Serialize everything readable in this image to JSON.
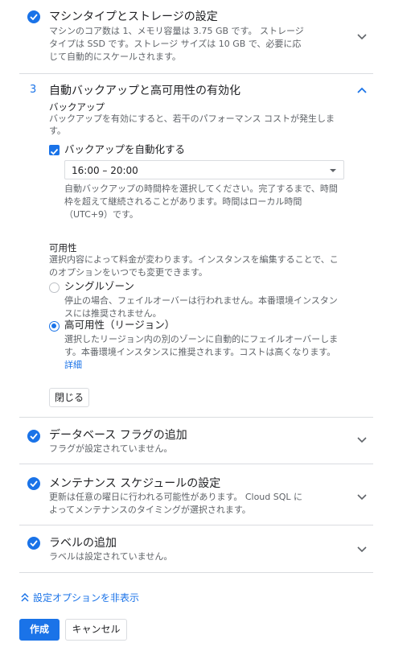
{
  "sections": {
    "machine": {
      "title": "マシンタイプとストレージの設定",
      "desc_line1": "マシンのコア数は 1、メモリ容量は 3.75 GB です。 ストレージ",
      "desc_line2": "タイプは SSD です。ストレージ サイズは 10 GB で、必要に応",
      "desc_line3": "じて自動的にスケールされます。"
    },
    "backup": {
      "number": "3",
      "title": "自動バックアップと高可用性の有効化",
      "backup_label": "バックアップ",
      "backup_desc_line1": "バックアップを有効にすると、若干のパフォーマンス コストが発生しま",
      "backup_desc_line2": "す。",
      "auto_checkbox_label": "バックアップを自動化する",
      "auto_checked": true,
      "window_value": "16:00 – 20:00",
      "window_help_line1": "自動バックアップの時間枠を選択してください。完了するまで、時間",
      "window_help_line2": "枠を超えて継続されることがあります。時間はローカル時間",
      "window_help_line3": "（UTC+9）です。",
      "ha_label": "可用性",
      "ha_desc_line1": "選択内容によって料金が変わります。インスタンスを編集することで、こ",
      "ha_desc_line2": "のオプションをいつでも変更できます。",
      "single_zone_label": "シングルゾーン",
      "single_zone_desc_line1": "停止の場合、フェイルオーバーは行われません。本番環境インスタン",
      "single_zone_desc_line2": "スには推奨されません。",
      "regional_label": "高可用性（リージョン）",
      "regional_desc_line1": "選択したリージョン内の別のゾーンに自動的にフェイルオーバーしま",
      "regional_desc_line2": "す。本番環境インスタンスに推奨されます。コストは高くなります。",
      "details_link": "詳細",
      "close_button": "閉じる",
      "selected_option": "regional"
    },
    "flags": {
      "title": "データベース フラグの追加",
      "desc": "フラグが設定されていません。"
    },
    "maintenance": {
      "title": "メンテナンス スケジュールの設定",
      "desc_line1": "更新は任意の曜日に行われる可能性があります。 Cloud SQL に",
      "desc_line2": "よってメンテナンスのタイミングが選択されます。"
    },
    "labels": {
      "title": "ラベルの追加",
      "desc": "ラベルは設定されていません。"
    }
  },
  "hide_options_link": "設定オプションを非表示",
  "create_button": "作成",
  "cancel_button": "キャンセル",
  "colors": {
    "accent": "#1a73e8",
    "divider": "#dadce0",
    "muted": "#5f6368"
  }
}
